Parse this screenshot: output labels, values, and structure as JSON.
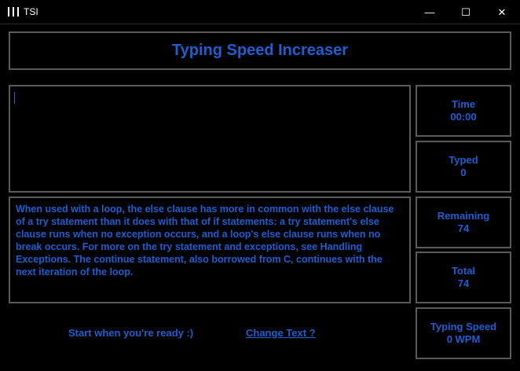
{
  "window": {
    "title": "TSI",
    "controls": {
      "minimize": "—",
      "maximize": "☐",
      "close": "✕"
    }
  },
  "header": {
    "title": "Typing Speed Increaser"
  },
  "input": {
    "value": ""
  },
  "passage": {
    "text": "When used with a loop, the else clause has more in common with the else clause of a try statement than it does with that of if statements: a try statement's else clause runs when no exception occurs, and a loop's else clause runs when no break occurs. For more on the try statement and exceptions, see Handling Exceptions. The continue statement, also borrowed from C, continues with the next iteration of the loop."
  },
  "stats": {
    "time": {
      "label": "Time",
      "value": "00:00"
    },
    "typed": {
      "label": "Typed",
      "value": "0"
    },
    "remaining": {
      "label": "Remaining",
      "value": "74"
    },
    "total": {
      "label": "Total",
      "value": "74"
    },
    "speed": {
      "label": "Typing Speed",
      "value": "0 WPM"
    }
  },
  "footer": {
    "status": "Start when you're ready :)",
    "change_text": "Change Text ?"
  },
  "colors": {
    "accent": "#1e5ed0",
    "border": "#5a5a5a",
    "background": "#000000"
  }
}
